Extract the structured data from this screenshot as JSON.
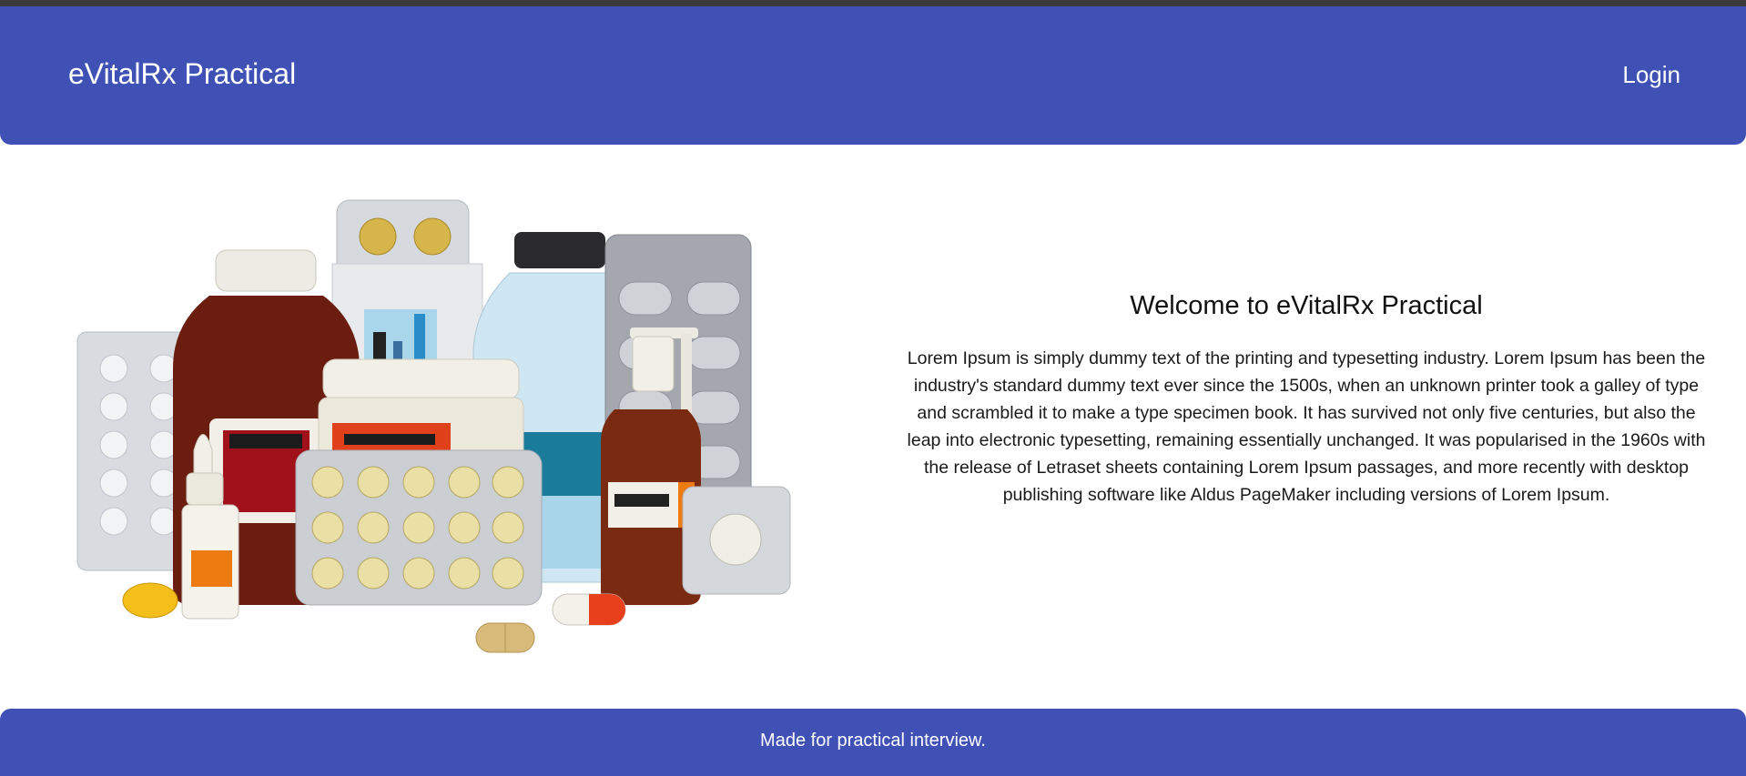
{
  "header": {
    "brand": "eVitalRx Practical",
    "login_label": "Login"
  },
  "hero": {
    "image_label": "medicines-illustration",
    "title": "Welcome to eVitalRx Practical",
    "body": "Lorem Ipsum is simply dummy text of the printing and typesetting industry. Lorem Ipsum has been the industry's standard dummy text ever since the 1500s, when an unknown printer took a galley of type and scrambled it to make a type specimen book. It has survived not only five centuries, but also the leap into electronic typesetting, remaining essentially unchanged. It was popularised in the 1960s with the release of Letraset sheets containing Lorem Ipsum passages, and more recently with desktop publishing software like Aldus PageMaker including versions of Lorem Ipsum."
  },
  "footer": {
    "text": "Made for practical interview."
  },
  "colors": {
    "primary": "#3f51b5",
    "topbar": "#3b3b3b"
  }
}
